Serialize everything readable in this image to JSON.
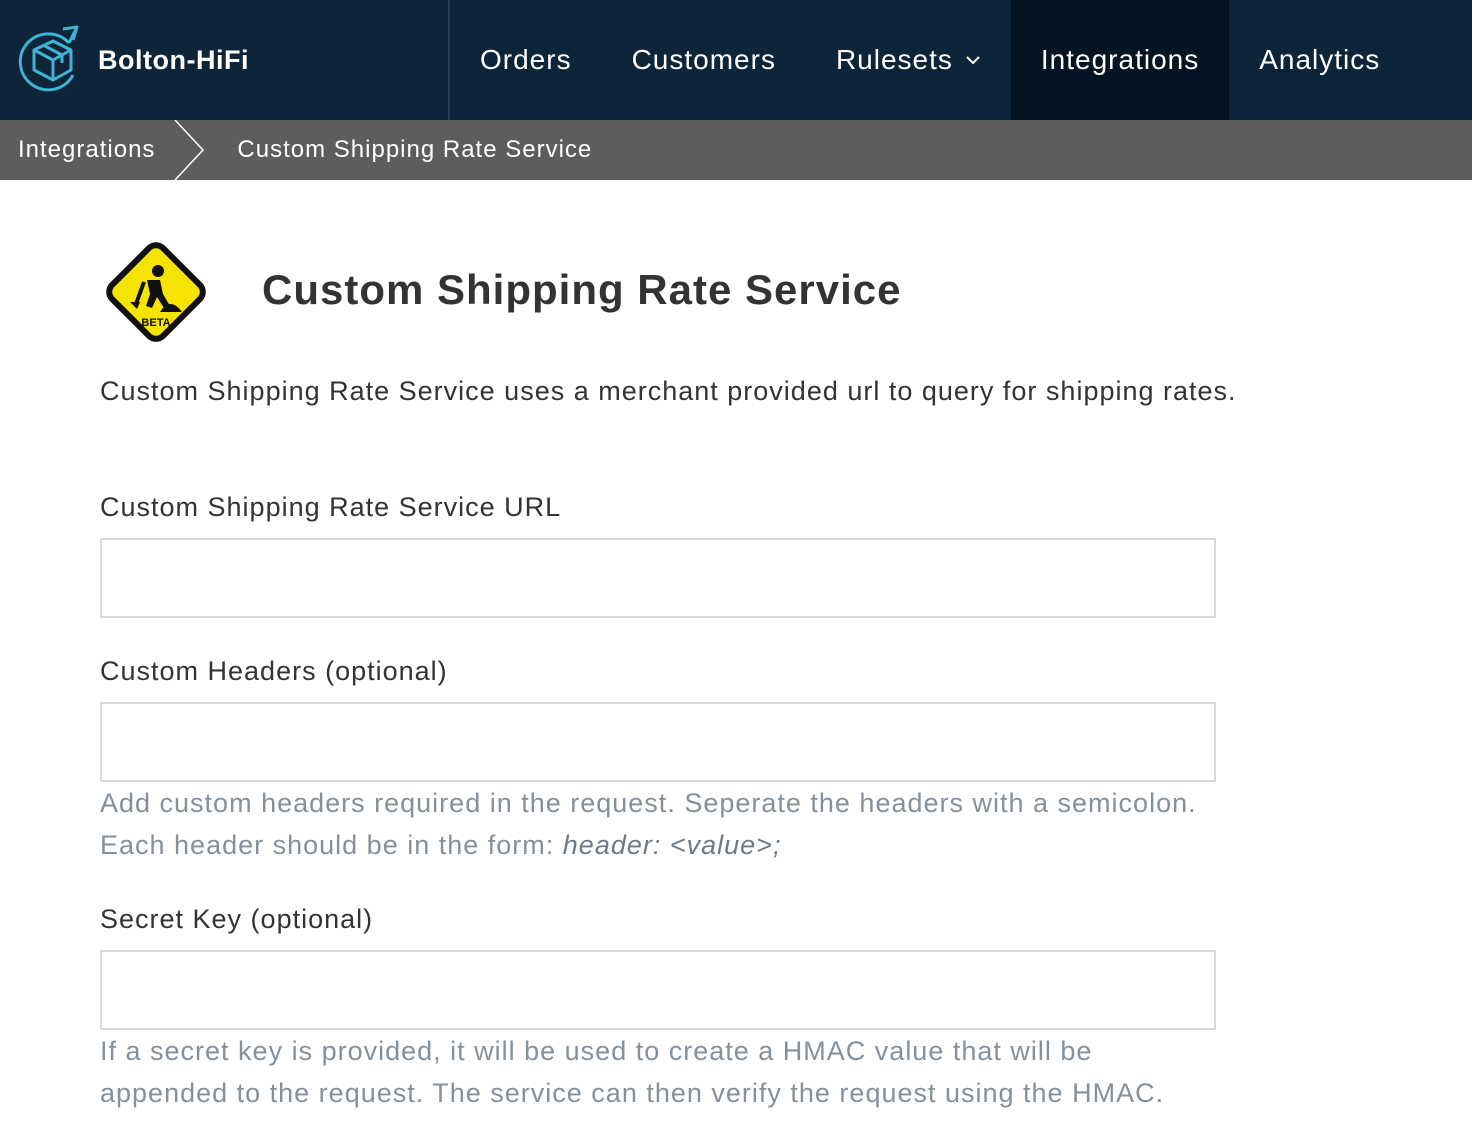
{
  "app": {
    "brand_name": "Bolton-HiFi"
  },
  "nav": {
    "items": [
      {
        "label": "Orders"
      },
      {
        "label": "Customers"
      },
      {
        "label": "Rulesets",
        "has_dropdown": true
      },
      {
        "label": "Integrations",
        "active": true
      },
      {
        "label": "Analytics"
      }
    ]
  },
  "breadcrumb": {
    "root": "Integrations",
    "current": "Custom Shipping Rate Service"
  },
  "page": {
    "badge_text": "BETA",
    "title": "Custom Shipping Rate Service",
    "description": "Custom Shipping Rate Service uses a merchant provided url to query for shipping rates."
  },
  "form": {
    "url": {
      "label": "Custom Shipping Rate Service URL",
      "value": ""
    },
    "headers": {
      "label": "Custom Headers (optional)",
      "value": "",
      "help_prefix": "Add custom headers required in the request. Seperate the headers with a semicolon. Each header should be in the form: ",
      "help_example": "header: <value>;"
    },
    "secret_key": {
      "label": "Secret Key (optional)",
      "value": "",
      "help": "If a secret key is provided, it will be used to create a HMAC value that will be appended to the request. The service can then verify the request using the HMAC."
    }
  },
  "colors": {
    "nav_bg": "#0e2438",
    "nav_active_bg": "#051422",
    "breadcrumb_bg": "#5d5d5d",
    "logo_accent": "#3fb4d6",
    "beta_yellow": "#f5e400",
    "help_text": "#86909a"
  },
  "icons": {
    "brand_logo": "rotating-box-logo",
    "rulesets_dropdown": "chevron-down-icon",
    "breadcrumb_separator": "chevron-right-icon",
    "beta_badge": "under-construction-sign"
  }
}
